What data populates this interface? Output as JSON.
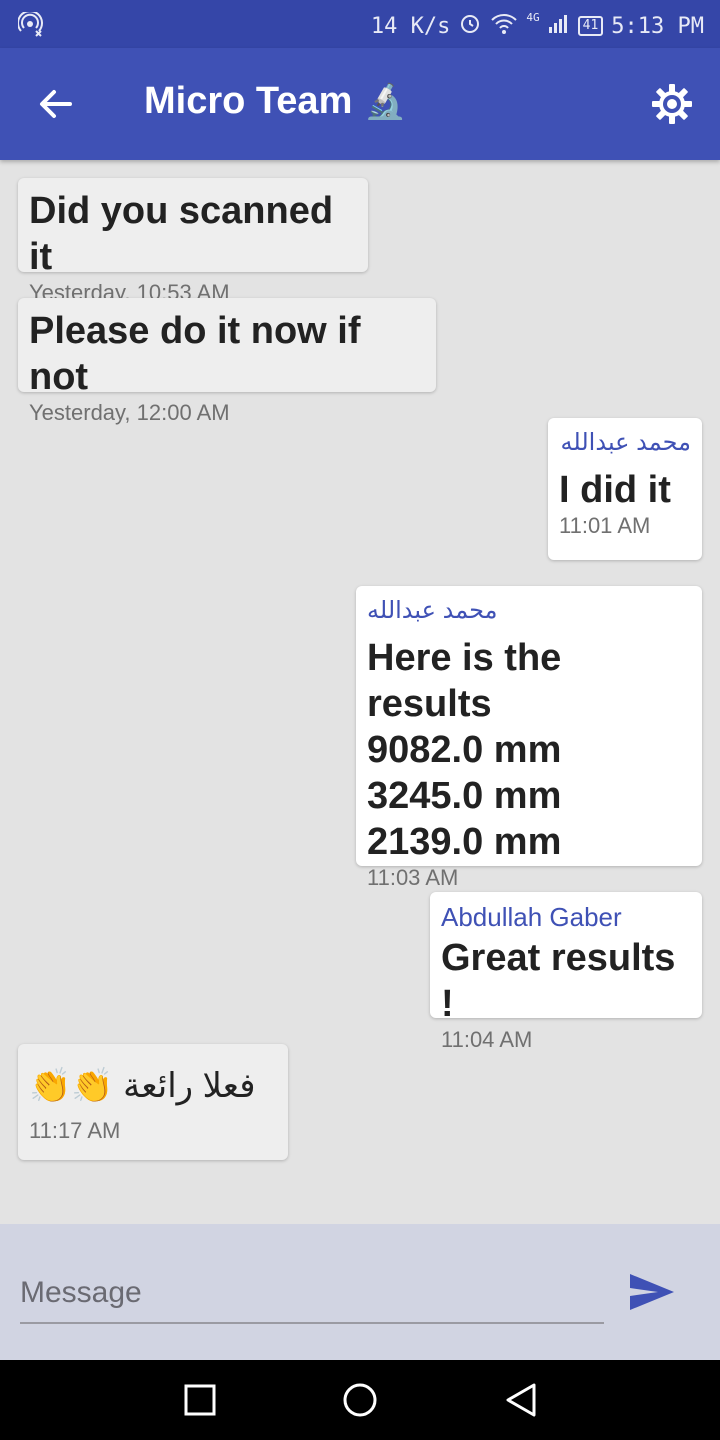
{
  "status_bar": {
    "speed": "14 K/s",
    "network": "4G",
    "battery": "41",
    "time": "5:13 PM"
  },
  "app_bar": {
    "title": "Micro Team",
    "title_emoji": "🔬",
    "back_icon": "arrow-left-icon",
    "settings_icon": "gear-icon"
  },
  "messages": [
    {
      "direction": "in",
      "text": "Did you scanned it",
      "time": "Yesterday, 10:53 AM"
    },
    {
      "direction": "in",
      "text": "Please do it now if not",
      "time": "Yesterday, 12:00 AM"
    },
    {
      "direction": "out",
      "sender": "محمد عبدالله",
      "text": "I did it",
      "time": "11:01 AM"
    },
    {
      "direction": "out",
      "sender": "محمد عبدالله",
      "text": "Here is the results\n9082.0 mm\n3245.0 mm\n2139.0 mm",
      "time": "11:03 AM"
    },
    {
      "direction": "out",
      "sender": "Abdullah Gaber",
      "text": "Great results !",
      "time": "11:04 AM"
    },
    {
      "direction": "in",
      "text": "فعلا رائعة 👏👏",
      "time": "11:17 AM"
    }
  ],
  "composer": {
    "placeholder": "Message",
    "send_icon": "send-icon"
  },
  "colors": {
    "status_bar": "#3546a8",
    "app_bar": "#3f51b5",
    "accent": "#3f51b5",
    "background": "#e3e3e3"
  }
}
